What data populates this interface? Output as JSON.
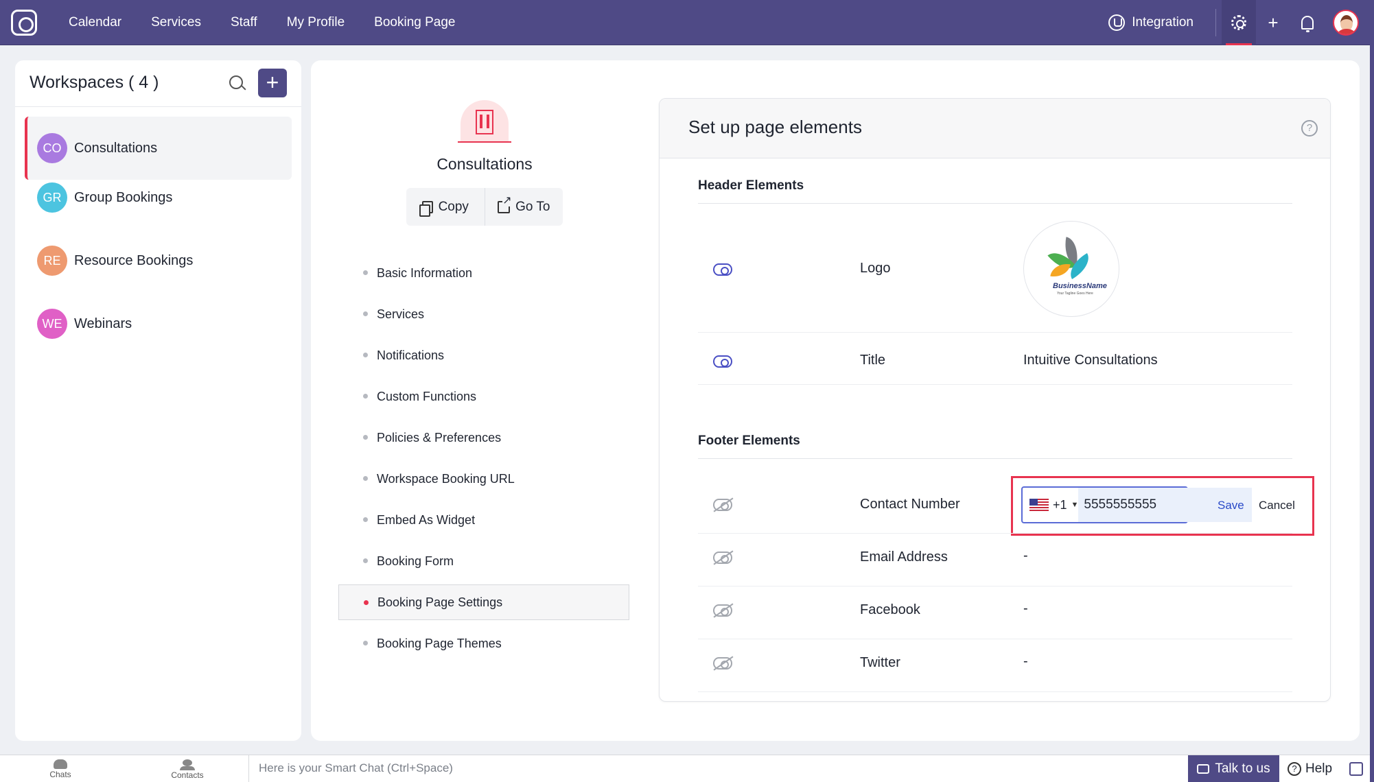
{
  "topbar": {
    "nav": [
      "Calendar",
      "Services",
      "Staff",
      "My Profile",
      "Booking Page"
    ],
    "integration_label": "Integration",
    "accent": "#4f4a86"
  },
  "sidebar": {
    "title": "Workspaces ( 4 )",
    "add_label": "+",
    "items": [
      {
        "initials": "CO",
        "name": "Consultations",
        "color": "#a97ae0",
        "active": true
      },
      {
        "initials": "GR",
        "name": "Group Bookings",
        "color": "#4cc4e0"
      },
      {
        "initials": "RE",
        "name": "Resource Bookings",
        "color": "#ee9a70"
      },
      {
        "initials": "WE",
        "name": "Webinars",
        "color": "#e060c6"
      }
    ]
  },
  "workspace": {
    "name": "Consultations",
    "copy_label": "Copy",
    "goto_label": "Go To"
  },
  "menu": [
    "Basic Information",
    "Services",
    "Notifications",
    "Custom Functions",
    "Policies & Preferences",
    "Workspace Booking URL",
    "Embed As Widget",
    "Booking Form",
    "Booking Page Settings",
    "Booking Page Themes"
  ],
  "menu_active": "Booking Page Settings",
  "card": {
    "title": "Set up page elements",
    "help": "?",
    "header_section": "Header Elements",
    "footer_section": "Footer Elements",
    "header_rows": [
      {
        "label": "Logo",
        "logo_text": "BusinessName",
        "logo_sub": "Your Tagline Goes Here"
      },
      {
        "label": "Title",
        "value": "Intuitive Consultations"
      }
    ],
    "footer_rows": [
      {
        "label": "Contact Number"
      },
      {
        "label": "Email Address",
        "value": "-"
      },
      {
        "label": "Facebook",
        "value": "-"
      },
      {
        "label": "Twitter",
        "value": "-"
      }
    ],
    "contact_edit": {
      "country_code": "+1",
      "number": "5555555555",
      "save_label": "Save",
      "cancel_label": "Cancel"
    }
  },
  "bottombar": {
    "chats": "Chats",
    "contacts": "Contacts",
    "smart_chat": "Here is your Smart Chat (Ctrl+Space)",
    "talk": "Talk to us",
    "help": "Help"
  }
}
